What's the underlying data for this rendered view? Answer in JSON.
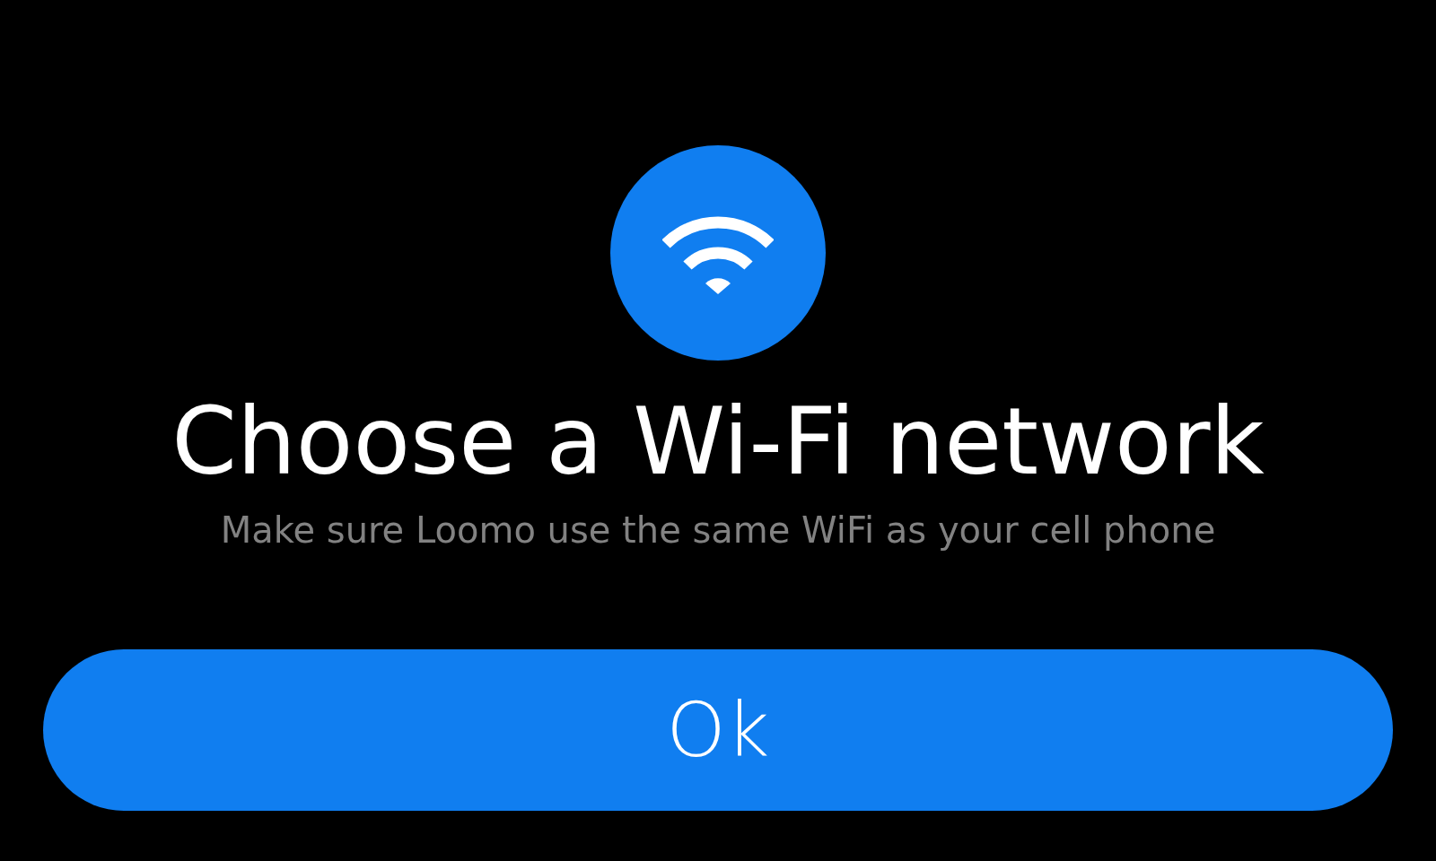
{
  "title": "Choose a Wi-Fi network",
  "subtitle": "Make sure Loomo use the same WiFi as your cell phone",
  "buttons": [
    {
      "label": "Ok",
      "kind": "primary"
    }
  ]
}
